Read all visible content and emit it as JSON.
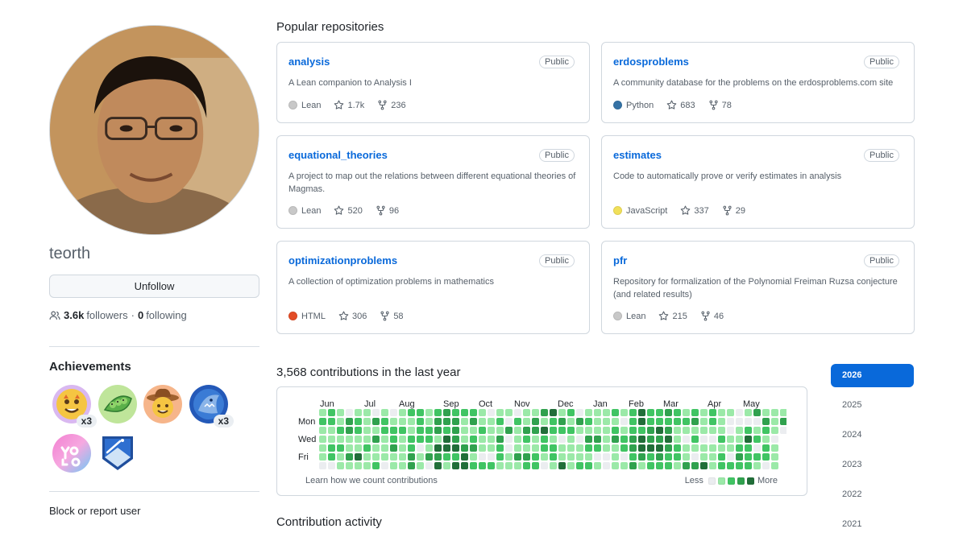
{
  "profile": {
    "username": "teorth",
    "unfollow_label": "Unfollow",
    "followers_count": "3.6k",
    "followers_label": "followers",
    "separator": "·",
    "following_count": "0",
    "following_label": "following",
    "block_label": "Block or report user"
  },
  "achievements": {
    "title": "Achievements",
    "badges": [
      {
        "name": "starstruck",
        "count": "x3"
      },
      {
        "name": "pair-extraordinaire",
        "count": ""
      },
      {
        "name": "yolo-cowboy",
        "count": ""
      },
      {
        "name": "pull-shark",
        "count": "x3"
      },
      {
        "name": "yolo",
        "count": ""
      },
      {
        "name": "arctic-code-vault",
        "count": ""
      }
    ]
  },
  "repos": {
    "title": "Popular repositories",
    "items": [
      {
        "name": "analysis",
        "visibility": "Public",
        "description": "A Lean companion to Analysis I",
        "language": "Lean",
        "language_color": "#c8c8c8",
        "stars": "1.7k",
        "forks": "236"
      },
      {
        "name": "erdosproblems",
        "visibility": "Public",
        "description": "A community database for the problems on the erdosproblems.com site",
        "language": "Python",
        "language_color": "#3572A5",
        "stars": "683",
        "forks": "78"
      },
      {
        "name": "equational_theories",
        "visibility": "Public",
        "description": "A project to map out the relations between different equational theories of Magmas.",
        "language": "Lean",
        "language_color": "#c8c8c8",
        "stars": "520",
        "forks": "96"
      },
      {
        "name": "estimates",
        "visibility": "Public",
        "description": "Code to automatically prove or verify estimates in analysis",
        "language": "JavaScript",
        "language_color": "#f1e05a",
        "stars": "337",
        "forks": "29"
      },
      {
        "name": "optimizationproblems",
        "visibility": "Public",
        "description": "A collection of optimization problems in mathematics",
        "language": "HTML",
        "language_color": "#e34c26",
        "stars": "306",
        "forks": "58"
      },
      {
        "name": "pfr",
        "visibility": "Public",
        "description": "Repository for formalization of the Polynomial Freiman Ruzsa conjecture (and related results)",
        "language": "Lean",
        "language_color": "#c8c8c8",
        "stars": "215",
        "forks": "46"
      }
    ]
  },
  "contributions": {
    "title": "3,568 contributions in the last year",
    "months": [
      "Jun",
      "Jul",
      "Aug",
      "Sep",
      "Oct",
      "Nov",
      "Dec",
      "Jan",
      "Feb",
      "Mar",
      "Apr",
      "May"
    ],
    "days": [
      "Mon",
      "Wed",
      "Fri"
    ],
    "learn_label": "Learn how we count contributions",
    "less_label": "Less",
    "more_label": "More",
    "level_colors": [
      "#ebedf0",
      "#9be9a8",
      "#40c463",
      "#30a14e",
      "#216e39"
    ]
  },
  "activity": {
    "title": "Contribution activity"
  },
  "years": {
    "items": [
      "2026",
      "2025",
      "2024",
      "2023",
      "2022",
      "2021"
    ],
    "selected": "2026"
  },
  "colors": {
    "accent": "#0969da",
    "muted": "#57606a",
    "border": "#d0d7de"
  }
}
